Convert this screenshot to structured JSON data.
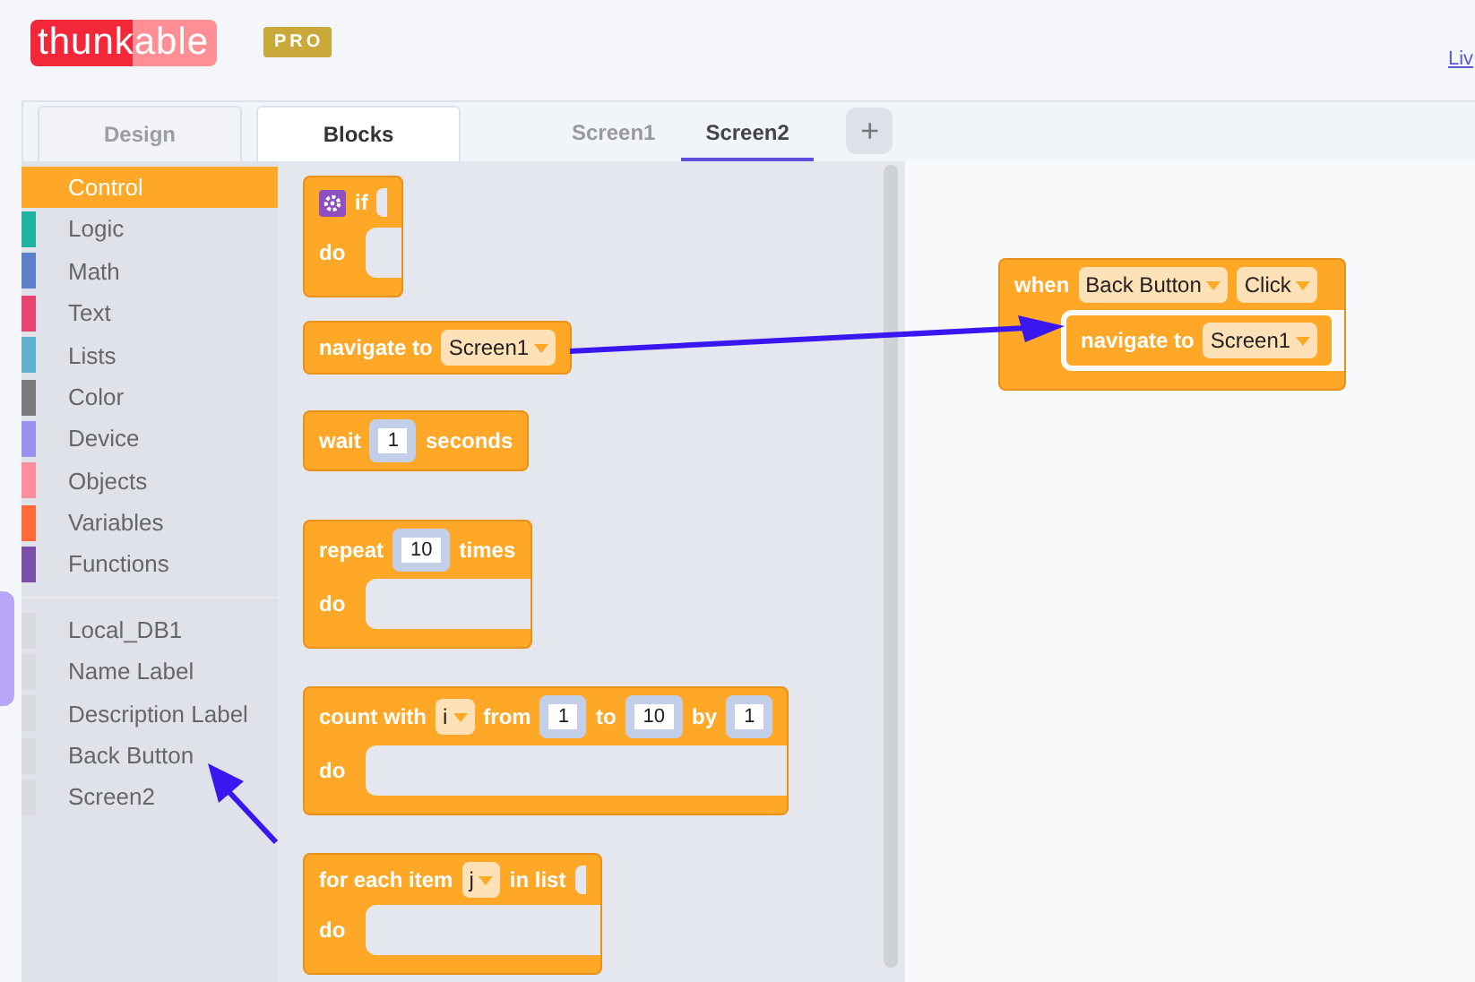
{
  "header": {
    "logo": "thunkable",
    "badge": "PRO",
    "link": "Liv"
  },
  "tabs": [
    {
      "label": "Design",
      "selected": false
    },
    {
      "label": "Blocks",
      "selected": true
    }
  ],
  "screens": [
    {
      "label": "Screen1",
      "selected": false
    },
    {
      "label": "Screen2",
      "selected": true
    }
  ],
  "add_screen": "+",
  "categories": [
    {
      "label": "Control",
      "color": "#ffa726",
      "selected": true
    },
    {
      "label": "Logic",
      "color": "#1db3a0",
      "selected": false
    },
    {
      "label": "Math",
      "color": "#5b80c8",
      "selected": false
    },
    {
      "label": "Text",
      "color": "#e9436f",
      "selected": false
    },
    {
      "label": "Lists",
      "color": "#5fb2cf",
      "selected": false
    },
    {
      "label": "Color",
      "color": "#7a7a7a",
      "selected": false
    },
    {
      "label": "Device",
      "color": "#9b8ff0",
      "selected": false
    },
    {
      "label": "Objects",
      "color": "#ff8d9b",
      "selected": false
    },
    {
      "label": "Variables",
      "color": "#ff6b3d",
      "selected": false
    },
    {
      "label": "Functions",
      "color": "#7a4fa8",
      "selected": false
    }
  ],
  "components": [
    {
      "label": "Local_DB1",
      "color": "#d9dbe0",
      "selected": false
    },
    {
      "label": "Name Label",
      "color": "#d9dbe0",
      "selected": false
    },
    {
      "label": "Description Label",
      "color": "#d9dbe0",
      "selected": false
    },
    {
      "label": "Back Button",
      "color": "#d9dbe0",
      "selected": false
    },
    {
      "label": "Screen2",
      "color": "#d9dbe0",
      "selected": false
    }
  ],
  "flyout_blocks": [
    {
      "rows": [
        {
          "kind": "line",
          "parts": [
            {
              "kind": "gear"
            },
            {
              "kind": "text",
              "text": "if"
            },
            {
              "kind": "socket"
            }
          ]
        },
        {
          "kind": "mouth",
          "label": "do"
        }
      ]
    },
    {
      "rows": [
        {
          "kind": "line",
          "parts": [
            {
              "kind": "text",
              "text": "navigate to"
            },
            {
              "kind": "dropdown",
              "text": "Screen1"
            }
          ]
        }
      ]
    },
    {
      "rows": [
        {
          "kind": "line",
          "parts": [
            {
              "kind": "text",
              "text": "wait"
            },
            {
              "kind": "number",
              "text": "1"
            },
            {
              "kind": "text",
              "text": "seconds"
            }
          ]
        }
      ]
    },
    {
      "rows": [
        {
          "kind": "line",
          "parts": [
            {
              "kind": "text",
              "text": "repeat"
            },
            {
              "kind": "number",
              "text": "10"
            },
            {
              "kind": "text",
              "text": "times"
            }
          ]
        },
        {
          "kind": "mouth",
          "label": "do"
        }
      ]
    },
    {
      "rows": [
        {
          "kind": "line",
          "parts": [
            {
              "kind": "text",
              "text": "count with"
            },
            {
              "kind": "dropdown",
              "text": "i"
            },
            {
              "kind": "text",
              "text": "from"
            },
            {
              "kind": "number",
              "text": "1"
            },
            {
              "kind": "text",
              "text": "to"
            },
            {
              "kind": "number",
              "text": "10"
            },
            {
              "kind": "text",
              "text": "by"
            },
            {
              "kind": "number",
              "text": "1"
            }
          ]
        },
        {
          "kind": "mouth",
          "label": "do"
        }
      ]
    },
    {
      "rows": [
        {
          "kind": "line",
          "parts": [
            {
              "kind": "text",
              "text": "for each item"
            },
            {
              "kind": "dropdown",
              "text": "j"
            },
            {
              "kind": "text",
              "text": "in list"
            },
            {
              "kind": "socket"
            }
          ]
        },
        {
          "kind": "mouth",
          "label": "do"
        }
      ]
    }
  ],
  "workspace_blocks": [
    {
      "rows": [
        {
          "kind": "line",
          "parts": [
            {
              "kind": "text",
              "text": "when"
            },
            {
              "kind": "dropdown",
              "text": "Back Button"
            },
            {
              "kind": "dropdown",
              "text": "Click"
            }
          ]
        },
        {
          "kind": "mouth",
          "blocks": [
            {
              "rows": [
                {
                  "kind": "line",
                  "parts": [
                    {
                      "kind": "text",
                      "text": "navigate to"
                    },
                    {
                      "kind": "dropdown",
                      "text": "Screen1"
                    }
                  ]
                }
              ]
            }
          ]
        }
      ]
    }
  ]
}
